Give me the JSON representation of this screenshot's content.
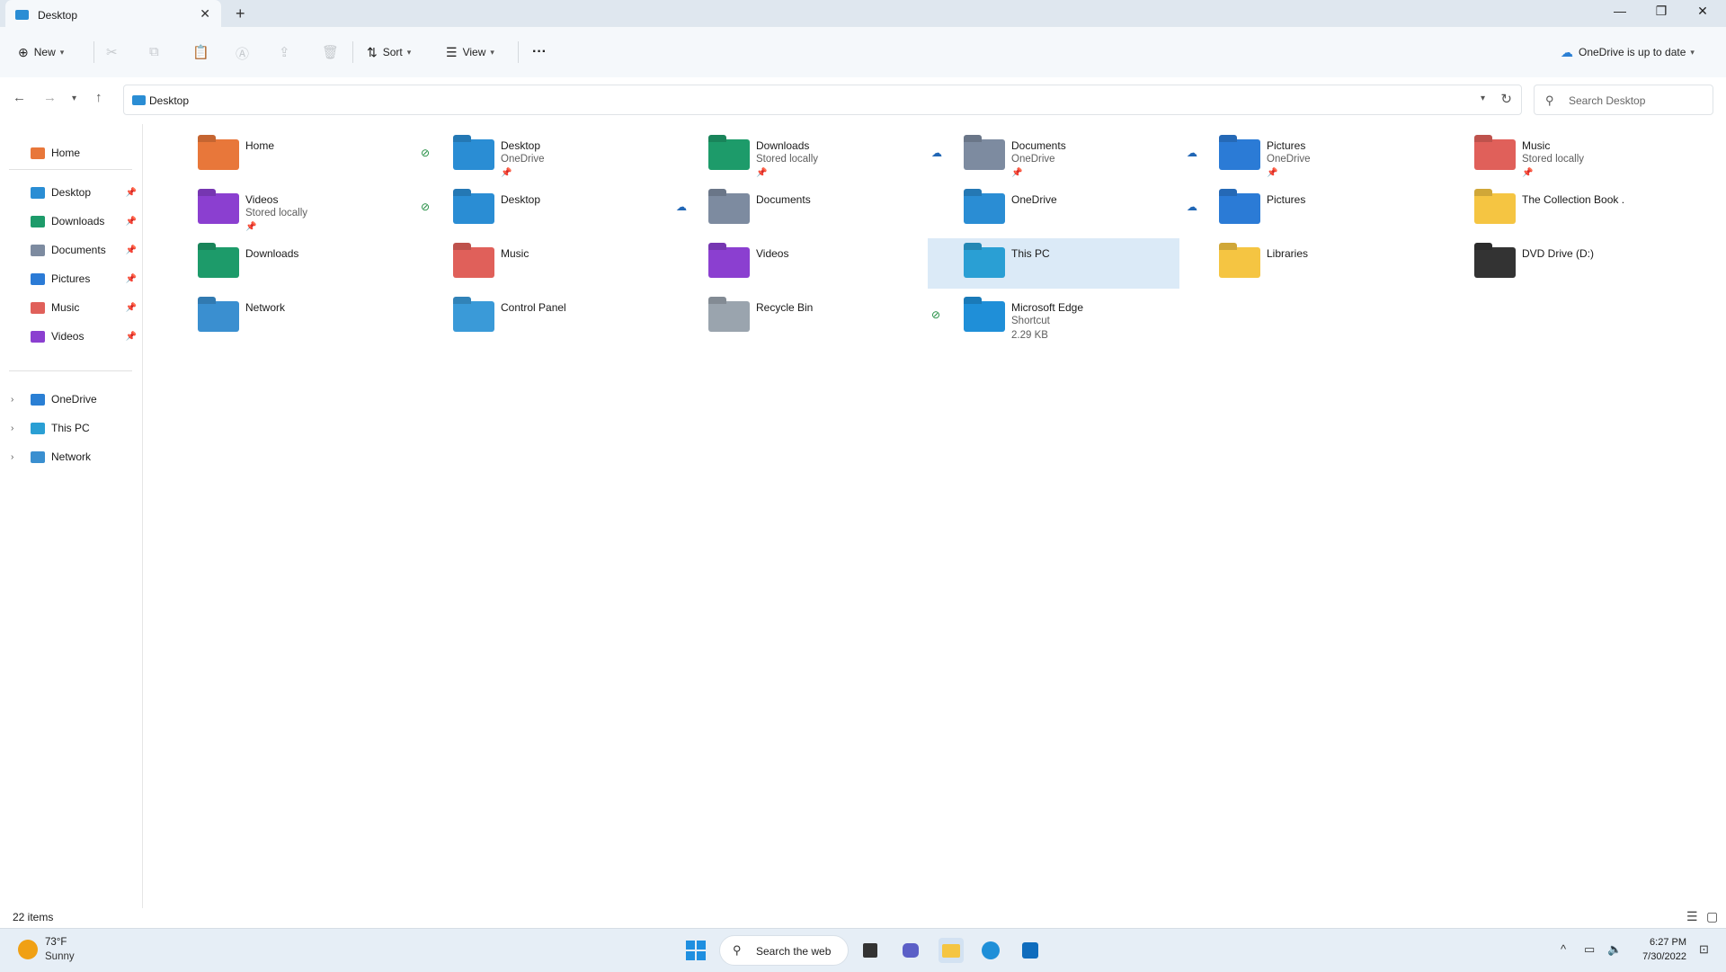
{
  "window": {
    "tab_title": "Desktop",
    "tab_close": "✕",
    "new_tab": "+",
    "minimize": "—",
    "restore": "❐",
    "close": "✕"
  },
  "toolbar": {
    "new_label": "New",
    "sort_label": "Sort",
    "view_label": "View",
    "more_label": "···",
    "onedrive_status": "OneDrive is up to date"
  },
  "address": {
    "path": "Desktop",
    "search_placeholder": "Search Desktop"
  },
  "sidebar": {
    "home": "Home",
    "pinned": [
      {
        "label": "Desktop",
        "color": "#2a8dd4"
      },
      {
        "label": "Downloads",
        "color": "#1d9b6a"
      },
      {
        "label": "Documents",
        "color": "#7d8ba0"
      },
      {
        "label": "Pictures",
        "color": "#2b7bd6"
      },
      {
        "label": "Music",
        "color": "#e0605a"
      },
      {
        "label": "Videos",
        "color": "#8b3fd0"
      }
    ],
    "trees": [
      {
        "label": "OneDrive",
        "color": "#2a7fd4"
      },
      {
        "label": "This PC",
        "color": "#2a9fd4"
      },
      {
        "label": "Network",
        "color": "#3a8fd0"
      }
    ]
  },
  "items": [
    {
      "name": "Home",
      "sub": "",
      "sub2": "",
      "status": "",
      "pinned": false,
      "icon": "home-icon",
      "color": "#e8773a"
    },
    {
      "name": "Desktop",
      "sub": "OneDrive",
      "sub2": "",
      "status": "sync",
      "pinned": true,
      "icon": "desktop-folder-icon",
      "color": "#2a8dd4"
    },
    {
      "name": "Downloads",
      "sub": "Stored locally",
      "sub2": "",
      "status": "",
      "pinned": true,
      "icon": "downloads-folder-icon",
      "color": "#1d9b6a"
    },
    {
      "name": "Documents",
      "sub": "OneDrive",
      "sub2": "",
      "status": "cloud",
      "pinned": true,
      "icon": "documents-folder-icon",
      "color": "#7d8ba0"
    },
    {
      "name": "Pictures",
      "sub": "OneDrive",
      "sub2": "",
      "status": "cloud",
      "pinned": true,
      "icon": "pictures-folder-icon",
      "color": "#2b7bd6"
    },
    {
      "name": "Music",
      "sub": "Stored locally",
      "sub2": "",
      "status": "",
      "pinned": true,
      "icon": "music-folder-icon",
      "color": "#e0605a"
    },
    {
      "name": "Videos",
      "sub": "Stored locally",
      "sub2": "",
      "status": "",
      "pinned": true,
      "icon": "videos-folder-icon",
      "color": "#8b3fd0"
    },
    {
      "name": "Desktop",
      "sub": "",
      "sub2": "",
      "status": "sync",
      "pinned": false,
      "icon": "desktop-folder-icon",
      "color": "#2a8dd4"
    },
    {
      "name": "Documents",
      "sub": "",
      "sub2": "",
      "status": "cloud",
      "pinned": false,
      "icon": "documents-folder-icon",
      "color": "#7d8ba0"
    },
    {
      "name": "OneDrive",
      "sub": "",
      "sub2": "",
      "status": "",
      "pinned": false,
      "icon": "onedrive-folder-icon",
      "color": "#2a8dd4"
    },
    {
      "name": "Pictures",
      "sub": "",
      "sub2": "",
      "status": "cloud",
      "pinned": false,
      "icon": "pictures-folder-icon",
      "color": "#2b7bd6"
    },
    {
      "name": "The Collection Book .",
      "sub": "",
      "sub2": "",
      "status": "",
      "pinned": false,
      "icon": "folder-icon",
      "color": "#f5c542"
    },
    {
      "name": "Downloads",
      "sub": "",
      "sub2": "",
      "status": "",
      "pinned": false,
      "icon": "downloads-folder-icon",
      "color": "#1d9b6a"
    },
    {
      "name": "Music",
      "sub": "",
      "sub2": "",
      "status": "",
      "pinned": false,
      "icon": "music-folder-icon",
      "color": "#e0605a"
    },
    {
      "name": "Videos",
      "sub": "",
      "sub2": "",
      "status": "",
      "pinned": false,
      "icon": "videos-folder-icon",
      "color": "#8b3fd0"
    },
    {
      "name": "This PC",
      "sub": "",
      "sub2": "",
      "status": "",
      "pinned": false,
      "icon": "this-pc-icon",
      "color": "#2a9fd4",
      "selected": true
    },
    {
      "name": "Libraries",
      "sub": "",
      "sub2": "",
      "status": "",
      "pinned": false,
      "icon": "libraries-icon",
      "color": "#f5c542"
    },
    {
      "name": "DVD Drive (D:)",
      "sub": "",
      "sub2": "",
      "status": "",
      "pinned": false,
      "icon": "dvd-drive-icon",
      "color": "#333333"
    },
    {
      "name": "Network",
      "sub": "",
      "sub2": "",
      "status": "",
      "pinned": false,
      "icon": "network-icon",
      "color": "#3a8fd0"
    },
    {
      "name": "Control Panel",
      "sub": "",
      "sub2": "",
      "status": "",
      "pinned": false,
      "icon": "control-panel-icon",
      "color": "#3a9ad8"
    },
    {
      "name": "Recycle Bin",
      "sub": "",
      "sub2": "",
      "status": "",
      "pinned": false,
      "icon": "recycle-bin-icon",
      "color": "#9aa4ae"
    },
    {
      "name": "Microsoft Edge",
      "sub": "Shortcut",
      "sub2": "2.29 KB",
      "status": "sync",
      "pinned": false,
      "icon": "edge-icon",
      "color": "#1f8fd8"
    }
  ],
  "statusbar": {
    "item_count": "22 items"
  },
  "taskbar": {
    "temperature": "73°F",
    "condition": "Sunny",
    "search_label": "Search the web",
    "time": "6:27 PM",
    "date": "7/30/2022"
  },
  "colors": {
    "accent": "#0067c0",
    "selection": "#dbeaf7",
    "sync_green": "#1b8a3c",
    "cloud_blue": "#2066b5"
  }
}
